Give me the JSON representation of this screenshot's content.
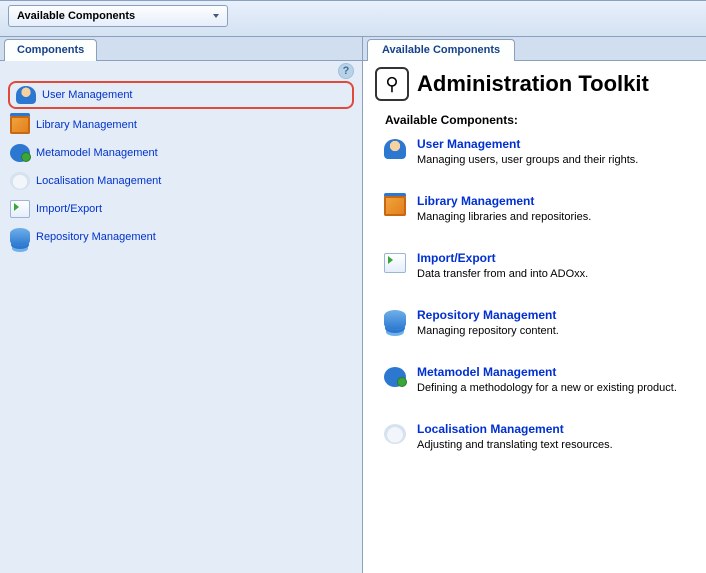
{
  "toolbar": {
    "dropdown_label": "Available Components"
  },
  "left": {
    "tab_label": "Components",
    "items": [
      {
        "label": "User Management",
        "icon": "user-icon",
        "selected": true
      },
      {
        "label": "Library Management",
        "icon": "library-icon"
      },
      {
        "label": "Metamodel Management",
        "icon": "metamodel-icon"
      },
      {
        "label": "Localisation Management",
        "icon": "localisation-icon"
      },
      {
        "label": "Import/Export",
        "icon": "import-export-icon"
      },
      {
        "label": "Repository Management",
        "icon": "repository-icon"
      }
    ]
  },
  "right": {
    "tab_label": "Available Components",
    "title": "Administration Toolkit",
    "subheading": "Available Components:",
    "components": [
      {
        "title": "User Management",
        "desc": "Managing users, user groups and their rights.",
        "icon": "user-icon"
      },
      {
        "title": "Library Management",
        "desc": "Managing libraries and repositories.",
        "icon": "library-icon"
      },
      {
        "title": "Import/Export",
        "desc": "Data transfer from and into ADOxx.",
        "icon": "import-export-icon"
      },
      {
        "title": "Repository Management",
        "desc": "Managing repository content.",
        "icon": "repository-icon"
      },
      {
        "title": "Metamodel Management",
        "desc": "Defining a methodology for a new or existing product.",
        "icon": "metamodel-icon"
      },
      {
        "title": "Localisation Management",
        "desc": "Adjusting and translating text resources.",
        "icon": "localisation-icon"
      }
    ]
  }
}
